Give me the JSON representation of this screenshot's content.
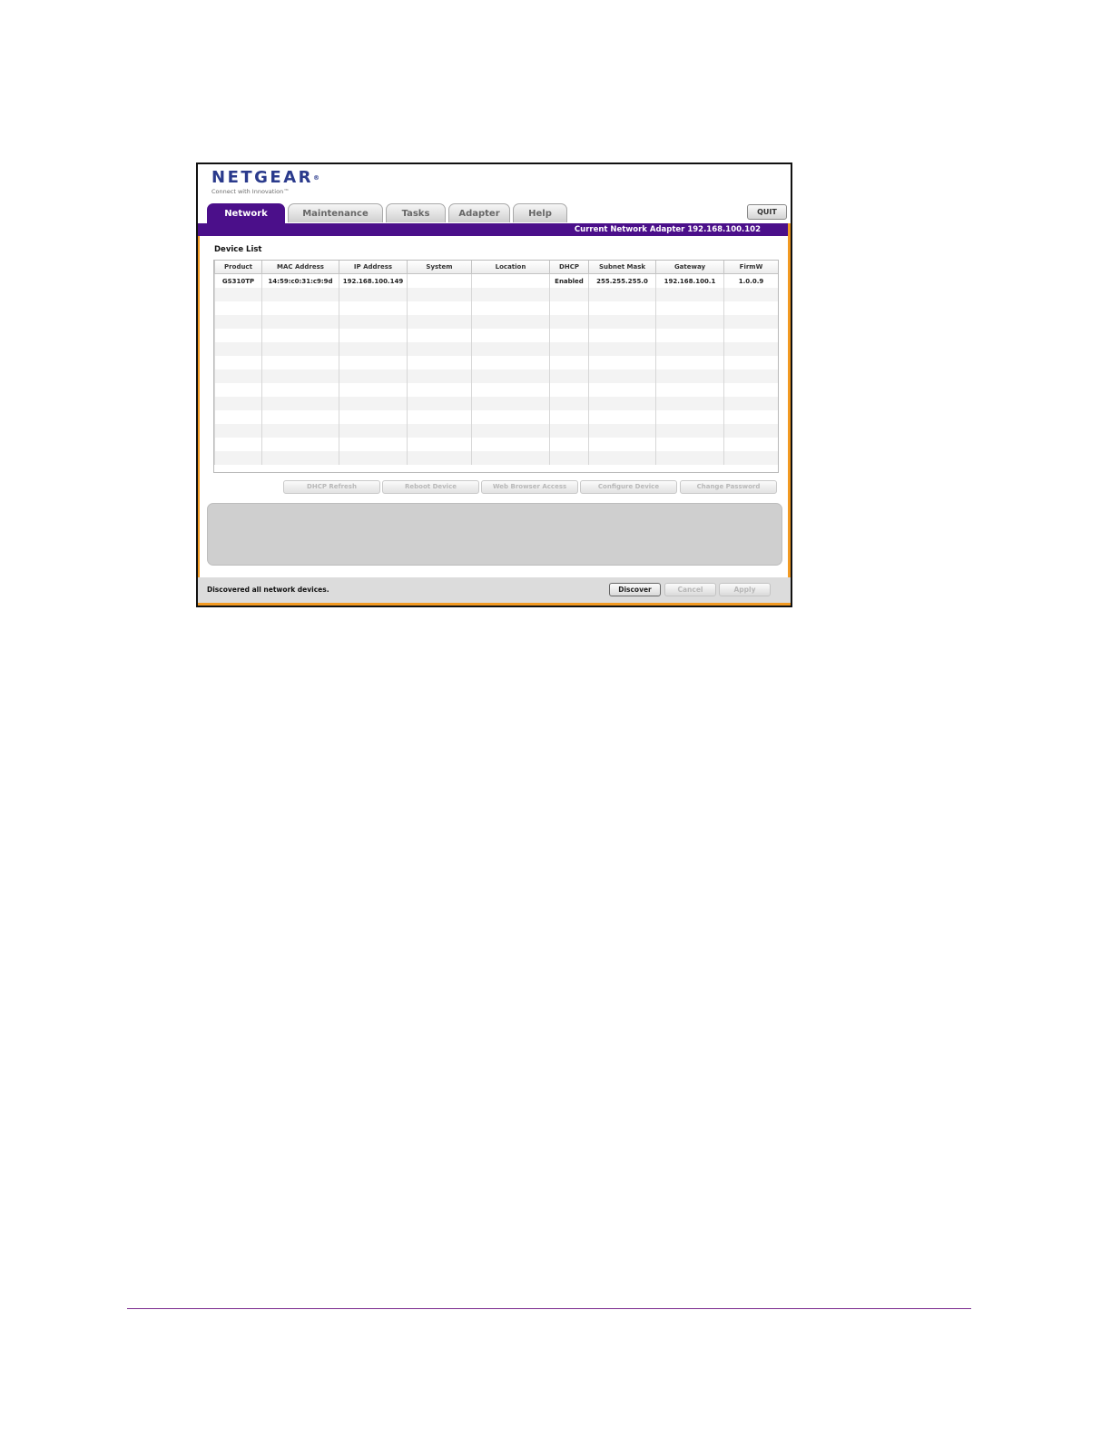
{
  "brand": {
    "logo_text": "NETGEAR",
    "tagline": "Connect with Innovation™",
    "logo_color": "#2a3a8c"
  },
  "tabs": [
    {
      "label": "Network",
      "active": true
    },
    {
      "label": "Maintenance",
      "active": false
    },
    {
      "label": "Tasks",
      "active": false
    },
    {
      "label": "Adapter",
      "active": false
    },
    {
      "label": "Help",
      "active": false
    }
  ],
  "quit_label": "QUIT",
  "adapter_bar": {
    "text": "Current Network Adapter 192.168.100.102"
  },
  "device_list": {
    "title": "Device List",
    "columns": [
      "Product",
      "MAC Address",
      "IP Address",
      "System",
      "Location",
      "DHCP",
      "Subnet Mask",
      "Gateway",
      "FirmW"
    ],
    "rows": [
      [
        "GS310TP",
        "14:59:c0:31:c9:9d",
        "192.168.100.149",
        "",
        "",
        "Enabled",
        "255.255.255.0",
        "192.168.100.1",
        "1.0.0.9"
      ]
    ]
  },
  "actions": [
    "DHCP Refresh",
    "Reboot Device",
    "Web Browser Access",
    "Configure Device",
    "Change Password"
  ],
  "status": {
    "message": "Discovered all network devices.",
    "discover_label": "Discover",
    "cancel_label": "Cancel",
    "apply_label": "Apply"
  },
  "colors": {
    "accent_purple": "#4b0f8a",
    "accent_orange": "#f29a22",
    "footer_rule": "#7a2a8e"
  }
}
